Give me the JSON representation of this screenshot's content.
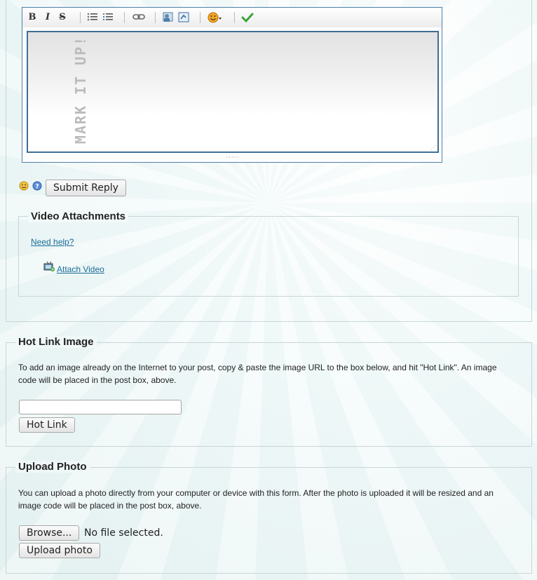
{
  "editor": {
    "watermark": "MARK IT UP!",
    "toolbar": {
      "bold": "B",
      "italic": "I",
      "strike": "S"
    }
  },
  "reply": {
    "submit_label": "Submit Reply"
  },
  "video": {
    "legend": "Video Attachments",
    "help_link": "Need help?",
    "attach_link": "Attach Video"
  },
  "hotlink": {
    "legend": "Hot Link Image",
    "description": "To add an image already on the Internet to your post, copy & paste the image URL to the box below, and hit \"Hot Link\". An image code will be placed in the post box, above.",
    "input_value": "",
    "button_label": "Hot Link"
  },
  "upload": {
    "legend": "Upload Photo",
    "description": "You can upload a photo directly from your computer or device with this form. After the photo is uploaded it will be resized and an image code will be placed in the post box, above.",
    "browse_label": "Browse...",
    "file_status": "No file selected.",
    "button_label": "Upload photo"
  },
  "colors": {
    "link": "#1a6e9a",
    "editor_border": "#4d7fa8",
    "check": "#3aa33a",
    "smiley": "#f5a623"
  }
}
